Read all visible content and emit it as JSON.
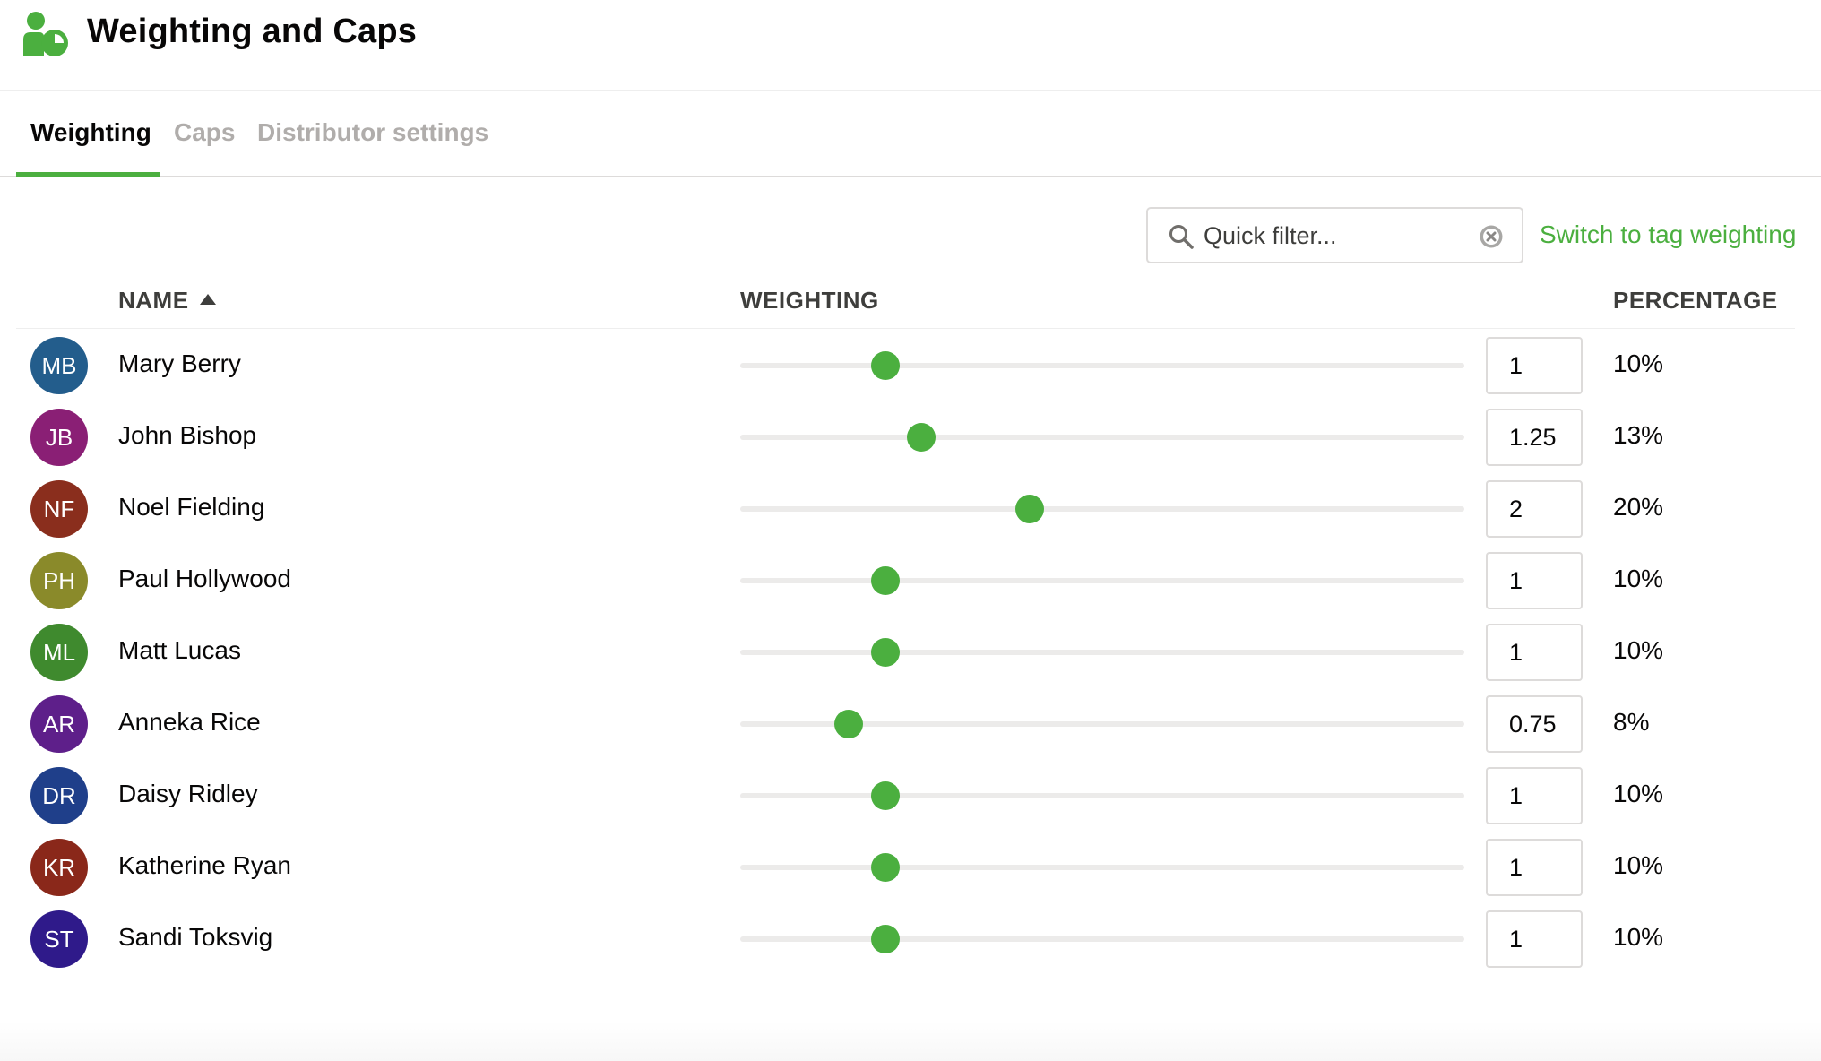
{
  "header": {
    "title": "Weighting and Caps",
    "logo_icon": "people-pie-logo-icon",
    "brand_color": "#4baf3f"
  },
  "tabs": [
    {
      "label": "Weighting",
      "active": true
    },
    {
      "label": "Caps",
      "active": false
    },
    {
      "label": "Distributor settings",
      "active": false
    }
  ],
  "toolbar": {
    "filter_placeholder": "Quick filter...",
    "filter_value": "",
    "search_icon": "search-icon",
    "clear_icon": "clear-icon",
    "switch_link": "Switch to tag weighting"
  },
  "table": {
    "columns": {
      "name": "NAME",
      "weighting": "WEIGHTING",
      "percentage": "PERCENTAGE"
    },
    "sort": {
      "column": "name",
      "direction": "ascending"
    },
    "slider_range": [
      0,
      5
    ],
    "rows": [
      {
        "initials": "MB",
        "name": "Mary Berry",
        "weight": "1",
        "percentage": "10%",
        "avatar_color": "#235d8c"
      },
      {
        "initials": "JB",
        "name": "John Bishop",
        "weight": "1.25",
        "percentage": "13%",
        "avatar_color": "#8a1f75"
      },
      {
        "initials": "NF",
        "name": "Noel Fielding",
        "weight": "2",
        "percentage": "20%",
        "avatar_color": "#8a2e1d"
      },
      {
        "initials": "PH",
        "name": "Paul Hollywood",
        "weight": "1",
        "percentage": "10%",
        "avatar_color": "#8a8a2a"
      },
      {
        "initials": "ML",
        "name": "Matt Lucas",
        "weight": "1",
        "percentage": "10%",
        "avatar_color": "#3f8a2e"
      },
      {
        "initials": "AR",
        "name": "Anneka Rice",
        "weight": "0.75",
        "percentage": "8%",
        "avatar_color": "#5e1f8a"
      },
      {
        "initials": "DR",
        "name": "Daisy Ridley",
        "weight": "1",
        "percentage": "10%",
        "avatar_color": "#1f3f8a"
      },
      {
        "initials": "KR",
        "name": "Katherine Ryan",
        "weight": "1",
        "percentage": "10%",
        "avatar_color": "#8a281a"
      },
      {
        "initials": "ST",
        "name": "Sandi Toksvig",
        "weight": "1",
        "percentage": "10%",
        "avatar_color": "#2f1a8a"
      }
    ]
  }
}
